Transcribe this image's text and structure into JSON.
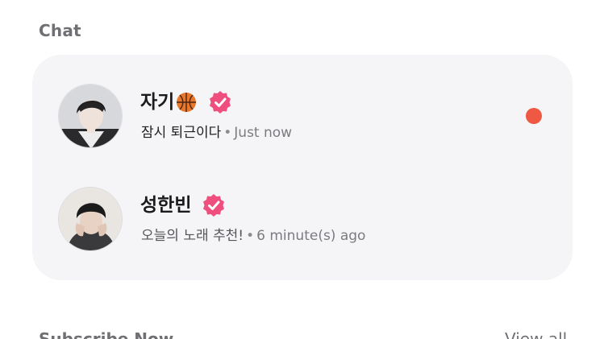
{
  "section": {
    "title": "Chat"
  },
  "chats": [
    {
      "name": "자기",
      "name_emoji": "basketball-emoji",
      "verified_icon": "verified-badge-icon",
      "preview": "잠시 퇴근이다",
      "separator": "•",
      "time": "Just now",
      "unread": true
    },
    {
      "name": "성한빈",
      "verified_icon": "verified-badge-icon",
      "preview": "오늘의 노래 추천!",
      "separator": "•",
      "time": "6 minute(s) ago",
      "unread": false
    }
  ],
  "next_section": {
    "title": "Subscribe Now",
    "view_all": "View all"
  },
  "colors": {
    "card_bg": "#f5f5f7",
    "verified": "#ef4f7e",
    "unread_dot": "#ee5944",
    "section_title": "#6f6f74"
  }
}
